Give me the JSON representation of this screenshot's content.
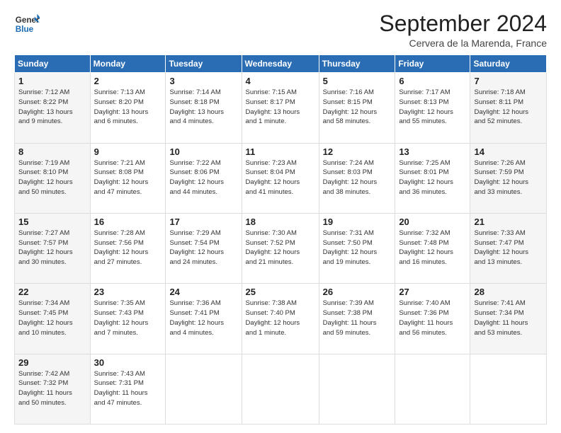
{
  "header": {
    "logo_general": "General",
    "logo_blue": "Blue",
    "month_title": "September 2024",
    "location": "Cervera de la Marenda, France"
  },
  "days_of_week": [
    "Sunday",
    "Monday",
    "Tuesday",
    "Wednesday",
    "Thursday",
    "Friday",
    "Saturday"
  ],
  "weeks": [
    [
      {
        "day": 1,
        "info": "Sunrise: 7:12 AM\nSunset: 8:22 PM\nDaylight: 13 hours\nand 9 minutes."
      },
      {
        "day": 2,
        "info": "Sunrise: 7:13 AM\nSunset: 8:20 PM\nDaylight: 13 hours\nand 6 minutes."
      },
      {
        "day": 3,
        "info": "Sunrise: 7:14 AM\nSunset: 8:18 PM\nDaylight: 13 hours\nand 4 minutes."
      },
      {
        "day": 4,
        "info": "Sunrise: 7:15 AM\nSunset: 8:17 PM\nDaylight: 13 hours\nand 1 minute."
      },
      {
        "day": 5,
        "info": "Sunrise: 7:16 AM\nSunset: 8:15 PM\nDaylight: 12 hours\nand 58 minutes."
      },
      {
        "day": 6,
        "info": "Sunrise: 7:17 AM\nSunset: 8:13 PM\nDaylight: 12 hours\nand 55 minutes."
      },
      {
        "day": 7,
        "info": "Sunrise: 7:18 AM\nSunset: 8:11 PM\nDaylight: 12 hours\nand 52 minutes."
      }
    ],
    [
      {
        "day": 8,
        "info": "Sunrise: 7:19 AM\nSunset: 8:10 PM\nDaylight: 12 hours\nand 50 minutes."
      },
      {
        "day": 9,
        "info": "Sunrise: 7:21 AM\nSunset: 8:08 PM\nDaylight: 12 hours\nand 47 minutes."
      },
      {
        "day": 10,
        "info": "Sunrise: 7:22 AM\nSunset: 8:06 PM\nDaylight: 12 hours\nand 44 minutes."
      },
      {
        "day": 11,
        "info": "Sunrise: 7:23 AM\nSunset: 8:04 PM\nDaylight: 12 hours\nand 41 minutes."
      },
      {
        "day": 12,
        "info": "Sunrise: 7:24 AM\nSunset: 8:03 PM\nDaylight: 12 hours\nand 38 minutes."
      },
      {
        "day": 13,
        "info": "Sunrise: 7:25 AM\nSunset: 8:01 PM\nDaylight: 12 hours\nand 36 minutes."
      },
      {
        "day": 14,
        "info": "Sunrise: 7:26 AM\nSunset: 7:59 PM\nDaylight: 12 hours\nand 33 minutes."
      }
    ],
    [
      {
        "day": 15,
        "info": "Sunrise: 7:27 AM\nSunset: 7:57 PM\nDaylight: 12 hours\nand 30 minutes."
      },
      {
        "day": 16,
        "info": "Sunrise: 7:28 AM\nSunset: 7:56 PM\nDaylight: 12 hours\nand 27 minutes."
      },
      {
        "day": 17,
        "info": "Sunrise: 7:29 AM\nSunset: 7:54 PM\nDaylight: 12 hours\nand 24 minutes."
      },
      {
        "day": 18,
        "info": "Sunrise: 7:30 AM\nSunset: 7:52 PM\nDaylight: 12 hours\nand 21 minutes."
      },
      {
        "day": 19,
        "info": "Sunrise: 7:31 AM\nSunset: 7:50 PM\nDaylight: 12 hours\nand 19 minutes."
      },
      {
        "day": 20,
        "info": "Sunrise: 7:32 AM\nSunset: 7:48 PM\nDaylight: 12 hours\nand 16 minutes."
      },
      {
        "day": 21,
        "info": "Sunrise: 7:33 AM\nSunset: 7:47 PM\nDaylight: 12 hours\nand 13 minutes."
      }
    ],
    [
      {
        "day": 22,
        "info": "Sunrise: 7:34 AM\nSunset: 7:45 PM\nDaylight: 12 hours\nand 10 minutes."
      },
      {
        "day": 23,
        "info": "Sunrise: 7:35 AM\nSunset: 7:43 PM\nDaylight: 12 hours\nand 7 minutes."
      },
      {
        "day": 24,
        "info": "Sunrise: 7:36 AM\nSunset: 7:41 PM\nDaylight: 12 hours\nand 4 minutes."
      },
      {
        "day": 25,
        "info": "Sunrise: 7:38 AM\nSunset: 7:40 PM\nDaylight: 12 hours\nand 1 minute."
      },
      {
        "day": 26,
        "info": "Sunrise: 7:39 AM\nSunset: 7:38 PM\nDaylight: 11 hours\nand 59 minutes."
      },
      {
        "day": 27,
        "info": "Sunrise: 7:40 AM\nSunset: 7:36 PM\nDaylight: 11 hours\nand 56 minutes."
      },
      {
        "day": 28,
        "info": "Sunrise: 7:41 AM\nSunset: 7:34 PM\nDaylight: 11 hours\nand 53 minutes."
      }
    ],
    [
      {
        "day": 29,
        "info": "Sunrise: 7:42 AM\nSunset: 7:32 PM\nDaylight: 11 hours\nand 50 minutes."
      },
      {
        "day": 30,
        "info": "Sunrise: 7:43 AM\nSunset: 7:31 PM\nDaylight: 11 hours\nand 47 minutes."
      },
      {
        "day": null,
        "info": ""
      },
      {
        "day": null,
        "info": ""
      },
      {
        "day": null,
        "info": ""
      },
      {
        "day": null,
        "info": ""
      },
      {
        "day": null,
        "info": ""
      }
    ]
  ]
}
